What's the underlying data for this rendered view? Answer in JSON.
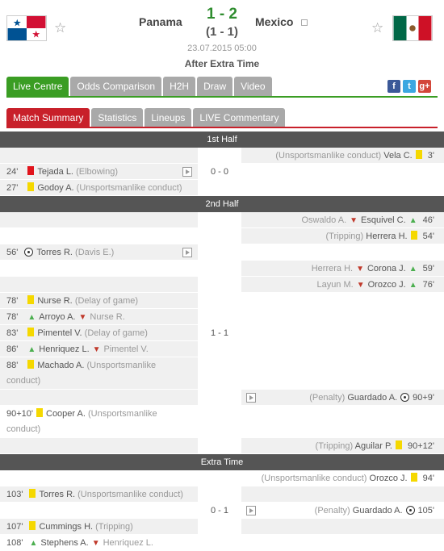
{
  "header": {
    "home_team": "Panama",
    "away_team": "Mexico",
    "score": "1 - 2",
    "score_sub": "(1 - 1)",
    "date": "23.07.2015 05:00",
    "status": "After Extra Time"
  },
  "tabs_main": [
    "Live Centre",
    "Odds Comparison",
    "H2H",
    "Draw",
    "Video"
  ],
  "tabs_sub": [
    "Match Summary",
    "Statistics",
    "Lineups",
    "LIVE Commentary"
  ],
  "social": [
    "f",
    "t",
    "g+"
  ],
  "sections": {
    "first_half": "1st Half",
    "second_half": "2nd Half",
    "extra_time": "Extra Time",
    "first_half_score": "0 - 0",
    "second_half_score": "1 - 1",
    "extra_time_score": "0 - 1"
  },
  "events": {
    "fh1": {
      "player": "Vela C.",
      "note": "(Unsportsmanlike conduct)",
      "min": "3'"
    },
    "fh2": {
      "min": "24'",
      "player": "Tejada L.",
      "note": "(Elbowing)"
    },
    "fh3": {
      "min": "27'",
      "player": "Godoy A.",
      "note": "(Unsportsmanlike conduct)"
    },
    "sh1": {
      "in": "Esquivel C.",
      "out": "Oswaldo A.",
      "min": "46'"
    },
    "sh2": {
      "note": "(Tripping)",
      "player": "Herrera H.",
      "min": "54'"
    },
    "sh3": {
      "min": "56'",
      "player": "Torres R.",
      "note": "(Davis E.)"
    },
    "sh4": {
      "in": "Corona J.",
      "out": "Herrera H.",
      "min": "59'"
    },
    "sh5": {
      "in": "Orozco J.",
      "out": "Layun M.",
      "min": "76'"
    },
    "sh6": {
      "min": "78'",
      "player": "Nurse R.",
      "note": "(Delay of game)"
    },
    "sh7": {
      "min": "78'",
      "in": "Arroyo A.",
      "out": "Nurse R."
    },
    "sh8": {
      "min": "83'",
      "player": "Pimentel V.",
      "note": "(Delay of game)"
    },
    "sh9": {
      "min": "86'",
      "in": "Henriquez L.",
      "out": "Pimentel V."
    },
    "sh10": {
      "min": "88'",
      "player": "Machado A.",
      "note": "(Unsportsmanlike",
      "note2": "conduct)"
    },
    "sh11": {
      "note": "(Penalty)",
      "player": "Guardado A.",
      "min": "90+9'"
    },
    "sh12": {
      "min": "90+10'",
      "player": "Cooper A.",
      "note": "(Unsportsmanlike",
      "note2": "conduct)"
    },
    "sh13": {
      "note": "(Tripping)",
      "player": "Aguilar P.",
      "min": "90+12'"
    },
    "et1": {
      "note": "(Unsportsmanlike conduct)",
      "player": "Orozco J.",
      "min": "94'"
    },
    "et2": {
      "min": "103'",
      "player": "Torres R.",
      "note": "(Unsportsmanlike conduct)"
    },
    "et3": {
      "note": "(Penalty)",
      "player": "Guardado A.",
      "min": "105'"
    },
    "et4": {
      "min": "107'",
      "player": "Cummings H.",
      "note": "(Tripping)"
    },
    "et5": {
      "min": "108'",
      "in": "Stephens A.",
      "out": "Henriquez L."
    }
  }
}
